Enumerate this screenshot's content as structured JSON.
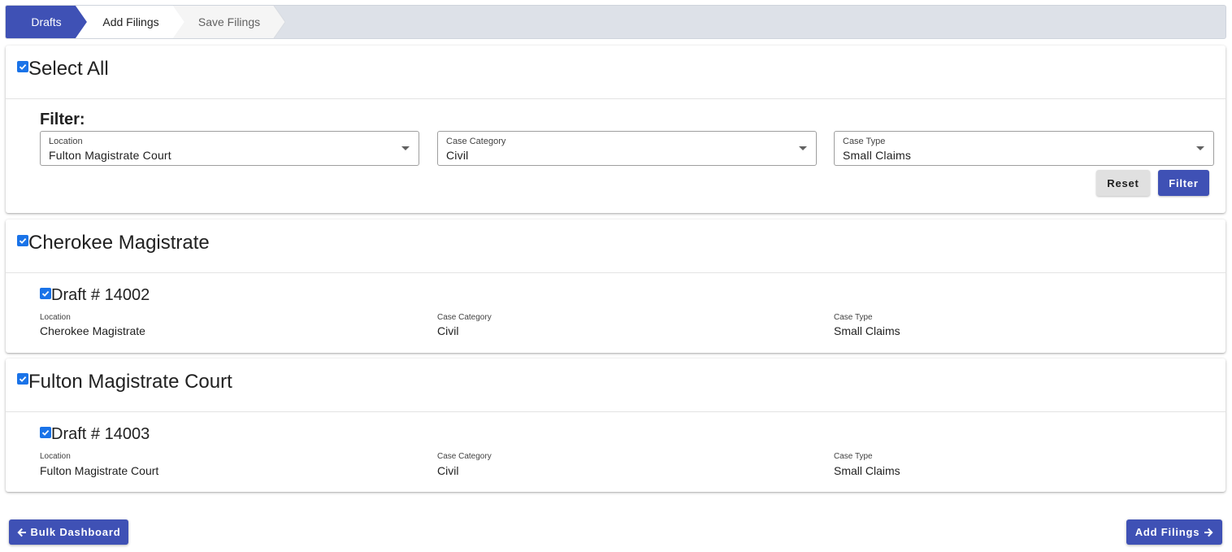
{
  "stepper": {
    "steps": [
      {
        "label": "Drafts",
        "state": "active"
      },
      {
        "label": "Add Filings",
        "state": "next"
      },
      {
        "label": "Save Filings",
        "state": "upcoming"
      }
    ]
  },
  "select_all": {
    "label": "Select All",
    "checked": true,
    "filter_label": "Filter:",
    "location": {
      "label": "Location",
      "value": "Fulton Magistrate Court"
    },
    "case_category": {
      "label": "Case Category",
      "value": "Civil"
    },
    "case_type": {
      "label": "Case Type",
      "value": "Small Claims"
    },
    "reset_label": "Reset",
    "filter_button_label": "Filter"
  },
  "groups": [
    {
      "title": "Cherokee Magistrate",
      "checked": true,
      "drafts": [
        {
          "title": "Draft # 14002",
          "checked": true,
          "location_label": "Location",
          "location": "Cherokee Magistrate",
          "case_category_label": "Case Category",
          "case_category": "Civil",
          "case_type_label": "Case Type",
          "case_type": "Small Claims"
        }
      ]
    },
    {
      "title": "Fulton Magistrate Court",
      "checked": true,
      "drafts": [
        {
          "title": "Draft # 14003",
          "checked": true,
          "location_label": "Location",
          "location": "Fulton Magistrate Court",
          "case_category_label": "Case Category",
          "case_category": "Civil",
          "case_type_label": "Case Type",
          "case_type": "Small Claims"
        }
      ]
    }
  ],
  "footer": {
    "back_label": "Bulk Dashboard",
    "next_label": "Add Filings"
  },
  "colors": {
    "primary": "#3f51b5",
    "checkbox": "#1a73e8",
    "stepper_bg": "#dde1e8"
  },
  "icons": {
    "back": "arrow-left-icon",
    "next": "arrow-right-icon",
    "select_caret": "caret-down-icon",
    "checkbox": "checkmark-icon"
  }
}
